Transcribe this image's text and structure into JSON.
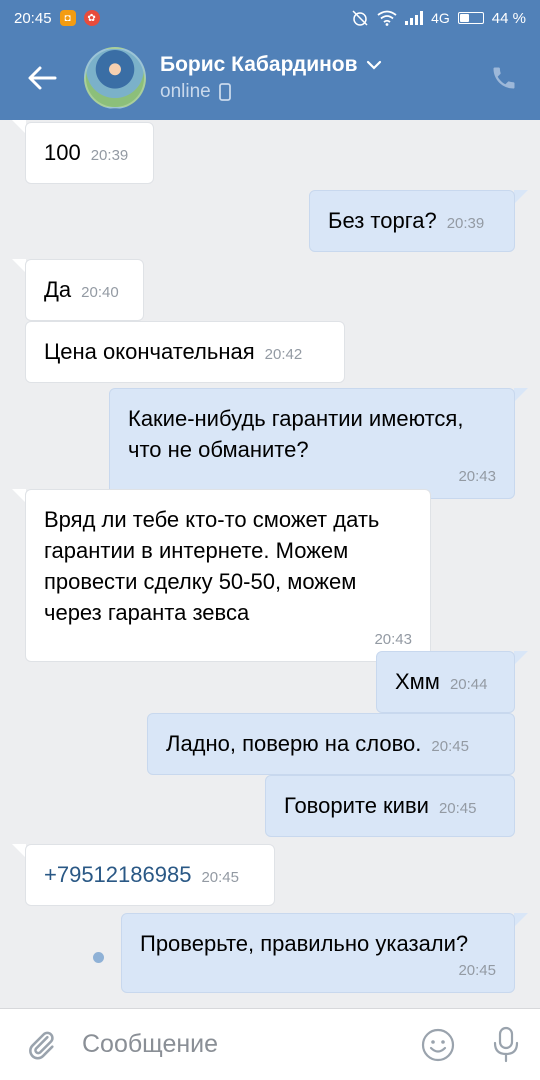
{
  "status_bar": {
    "time": "20:45",
    "network": "4G",
    "battery": "44 %",
    "battery_level": 0.44
  },
  "header": {
    "contact_name": "Борис Кабардинов",
    "status": "online",
    "icons": [
      "back-arrow-icon",
      "chevron-down-icon",
      "mobile-device-icon",
      "phone-icon"
    ]
  },
  "messages": [
    {
      "dir": "in",
      "text": "100",
      "time": "20:39"
    },
    {
      "dir": "out",
      "text": "Без торга?",
      "time": "20:39"
    },
    {
      "dir": "in",
      "text": "Да",
      "time": "20:40"
    },
    {
      "dir": "in",
      "text": "Цена окончательная",
      "time": "20:42"
    },
    {
      "dir": "out",
      "text": "Какие-нибудь гарантии имеются, что не обманите?",
      "time": "20:43"
    },
    {
      "dir": "in",
      "text": "Вряд ли тебе кто-то сможет дать гарантии в интернете. Можем провести сделку 50-50, можем через гаранта зевса",
      "time": "20:43"
    },
    {
      "dir": "out",
      "text": "Хмм",
      "time": "20:44"
    },
    {
      "dir": "out",
      "text": "Ладно, поверю на слово.",
      "time": "20:45"
    },
    {
      "dir": "out",
      "text": "Говорите киви",
      "time": "20:45"
    },
    {
      "dir": "in",
      "text": "+79512186985",
      "time": "20:45",
      "link": true
    },
    {
      "dir": "out",
      "text": "Проверьте, правильно указали?",
      "time": "20:45",
      "unread": true
    }
  ],
  "composer": {
    "placeholder": "Сообщение",
    "icons": [
      "paperclip-icon",
      "emoji-icon",
      "microphone-icon"
    ]
  },
  "colors": {
    "header": "#5181b8",
    "background": "#edeef0",
    "incoming_bubble": "#ffffff",
    "outgoing_bubble": "#d9e6f7",
    "link": "#2a5885"
  }
}
